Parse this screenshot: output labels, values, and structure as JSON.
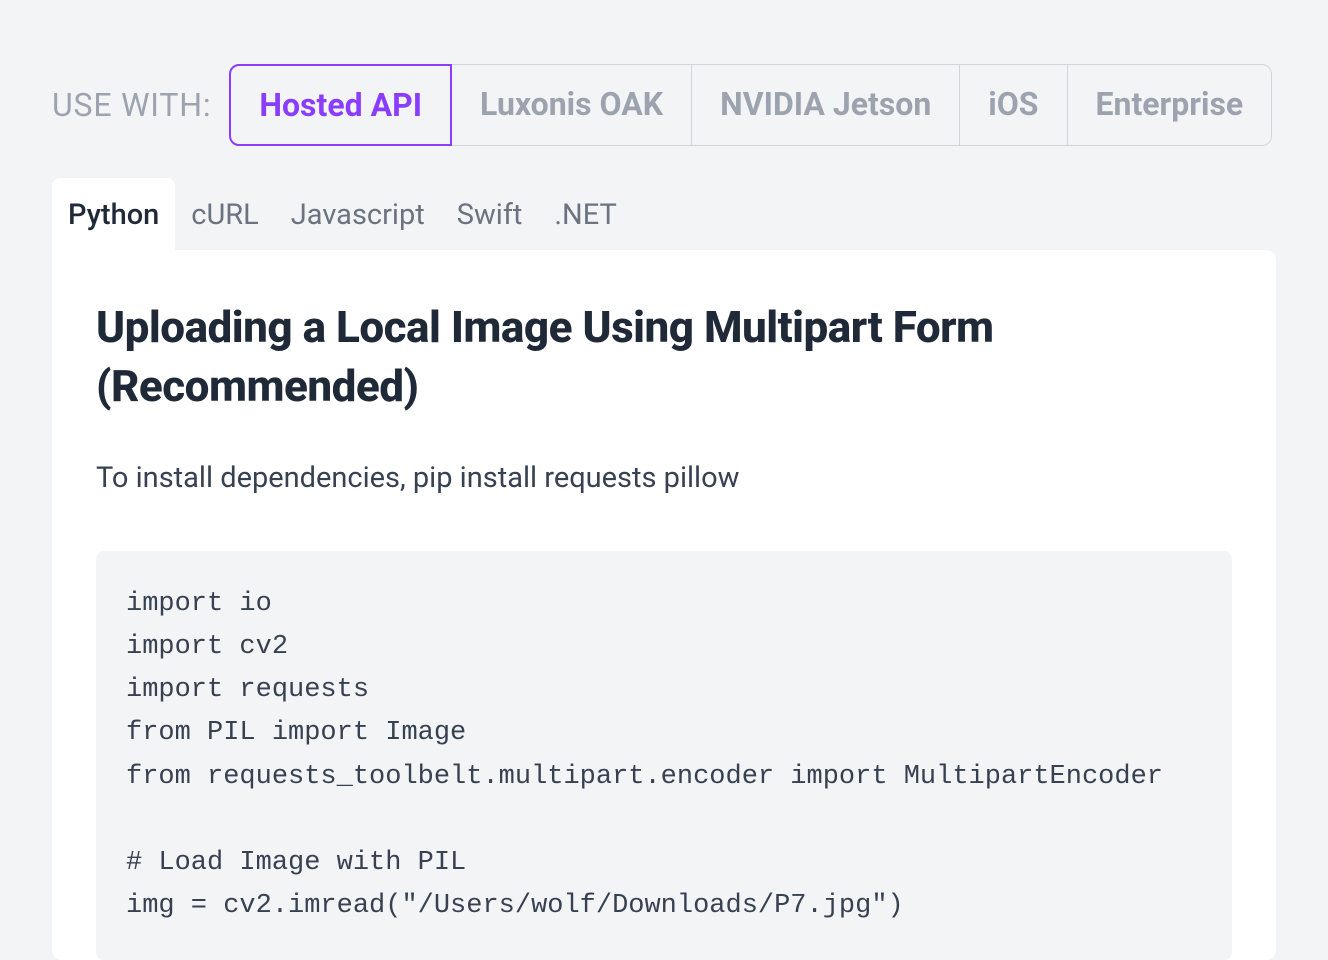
{
  "use_with_label": "USE WITH:",
  "platform_tabs": [
    {
      "label": "Hosted API",
      "active": true
    },
    {
      "label": "Luxonis OAK",
      "active": false
    },
    {
      "label": "NVIDIA Jetson",
      "active": false
    },
    {
      "label": "iOS",
      "active": false
    },
    {
      "label": "Enterprise",
      "active": false
    }
  ],
  "lang_tabs": [
    {
      "label": "Python",
      "active": true
    },
    {
      "label": "cURL",
      "active": false
    },
    {
      "label": "Javascript",
      "active": false
    },
    {
      "label": "Swift",
      "active": false
    },
    {
      "label": ".NET",
      "active": false
    }
  ],
  "content": {
    "title": "Uploading a Local Image Using Multipart Form (Recommended)",
    "description": "To install dependencies, pip install requests pillow",
    "code": "import io\nimport cv2\nimport requests\nfrom PIL import Image\nfrom requests_toolbelt.multipart.encoder import MultipartEncoder\n\n# Load Image with PIL\nimg = cv2.imread(\"/Users/wolf/Downloads/P7.jpg\")"
  }
}
